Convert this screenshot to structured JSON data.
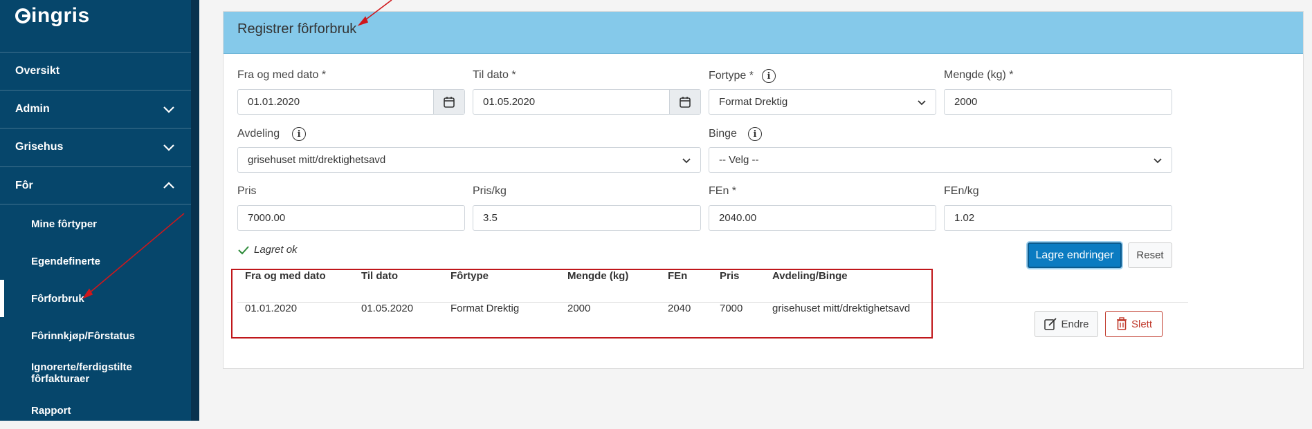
{
  "logo": {
    "text": "ingris"
  },
  "sidebar": {
    "items": [
      {
        "label": "Oversikt"
      },
      {
        "label": "Admin"
      },
      {
        "label": "Grisehus"
      },
      {
        "label": "Fôr"
      }
    ],
    "sub_items": [
      {
        "label": "Mine fôrtyper"
      },
      {
        "label": "Egendefinerte"
      },
      {
        "label": "Fôrforbruk"
      },
      {
        "label": "Fôrinnkjøp/Fôrstatus"
      },
      {
        "label": "Ignorerte/ferdigstilte fôrfakturaer"
      },
      {
        "label": "Rapport"
      }
    ]
  },
  "card": {
    "title": "Registrer fôrforbruk"
  },
  "form": {
    "fra_label": "Fra og med dato *",
    "fra_value": "01.01.2020",
    "til_label": "Til dato *",
    "til_value": "01.05.2020",
    "fortype_label": "Fortype *",
    "fortype_value": "Format Drektig",
    "mengde_label": "Mengde (kg) *",
    "mengde_value": "2000",
    "avdeling_label": "Avdeling",
    "avdeling_value": "grisehuset mitt/drektighetsavd",
    "binge_label": "Binge",
    "binge_value": "-- Velg --",
    "pris_label": "Pris",
    "pris_value": "7000.00",
    "priskg_label": "Pris/kg",
    "priskg_value": "3.5",
    "fen_label": "FEn *",
    "fen_value": "2040.00",
    "fenkg_label": "FEn/kg",
    "fenkg_value": "1.02",
    "status": "Lagret ok",
    "save_label": "Lagre endringer",
    "reset_label": "Reset"
  },
  "table": {
    "headers": [
      "Fra og med dato",
      "Til dato",
      "Fôrtype",
      "Mengde (kg)",
      "FEn",
      "Pris",
      "Avdeling/Binge"
    ],
    "rows": [
      [
        "01.01.2020",
        "01.05.2020",
        "Format Drektig",
        "2000",
        "2040",
        "7000",
        "grisehuset mitt/drektighetsavd"
      ]
    ],
    "edit_label": "Endre",
    "delete_label": "Slett"
  },
  "colors": {
    "sidebar": "#06466b",
    "header": "#85c9ea",
    "primary": "#0b7bc1",
    "danger": "#c0392b",
    "annotation": "#d0171b"
  }
}
